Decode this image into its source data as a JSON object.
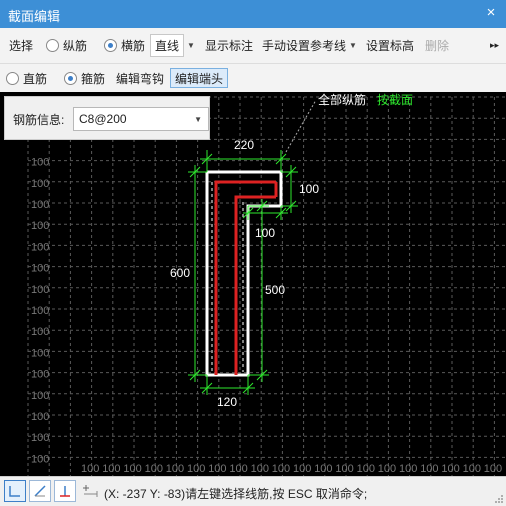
{
  "window": {
    "title": "截面编辑",
    "close_icon": "×"
  },
  "toolbar1": {
    "select_label": "选择",
    "radio_longitudinal": "纵筋",
    "radio_transverse": "横筋",
    "line_type_value": "直线",
    "show_annotation": "显示标注",
    "manual_ref_line": "手动设置参考线",
    "set_elevation": "设置标高",
    "delete_label": "删除",
    "more_icon": "▸▸"
  },
  "toolbar2": {
    "radio_straight": "直筋",
    "radio_stirrup": "箍筋",
    "edit_hook": "编辑弯钩",
    "edit_end": "编辑端头"
  },
  "info_panel": {
    "label": "钢筋信息:",
    "value": "C8@200"
  },
  "canvas": {
    "grid_label": "100",
    "top_note_white": "全部纵筋",
    "top_note_green": "按截面",
    "dims": {
      "top_width": "220",
      "flange_height": "100",
      "step_width": "100",
      "total_height": "600",
      "web_height": "500",
      "bottom_width": "120"
    }
  },
  "statusbar": {
    "message": "(X: -237 Y: -83)请左键选择线筋,按 ESC 取消命令;"
  }
}
